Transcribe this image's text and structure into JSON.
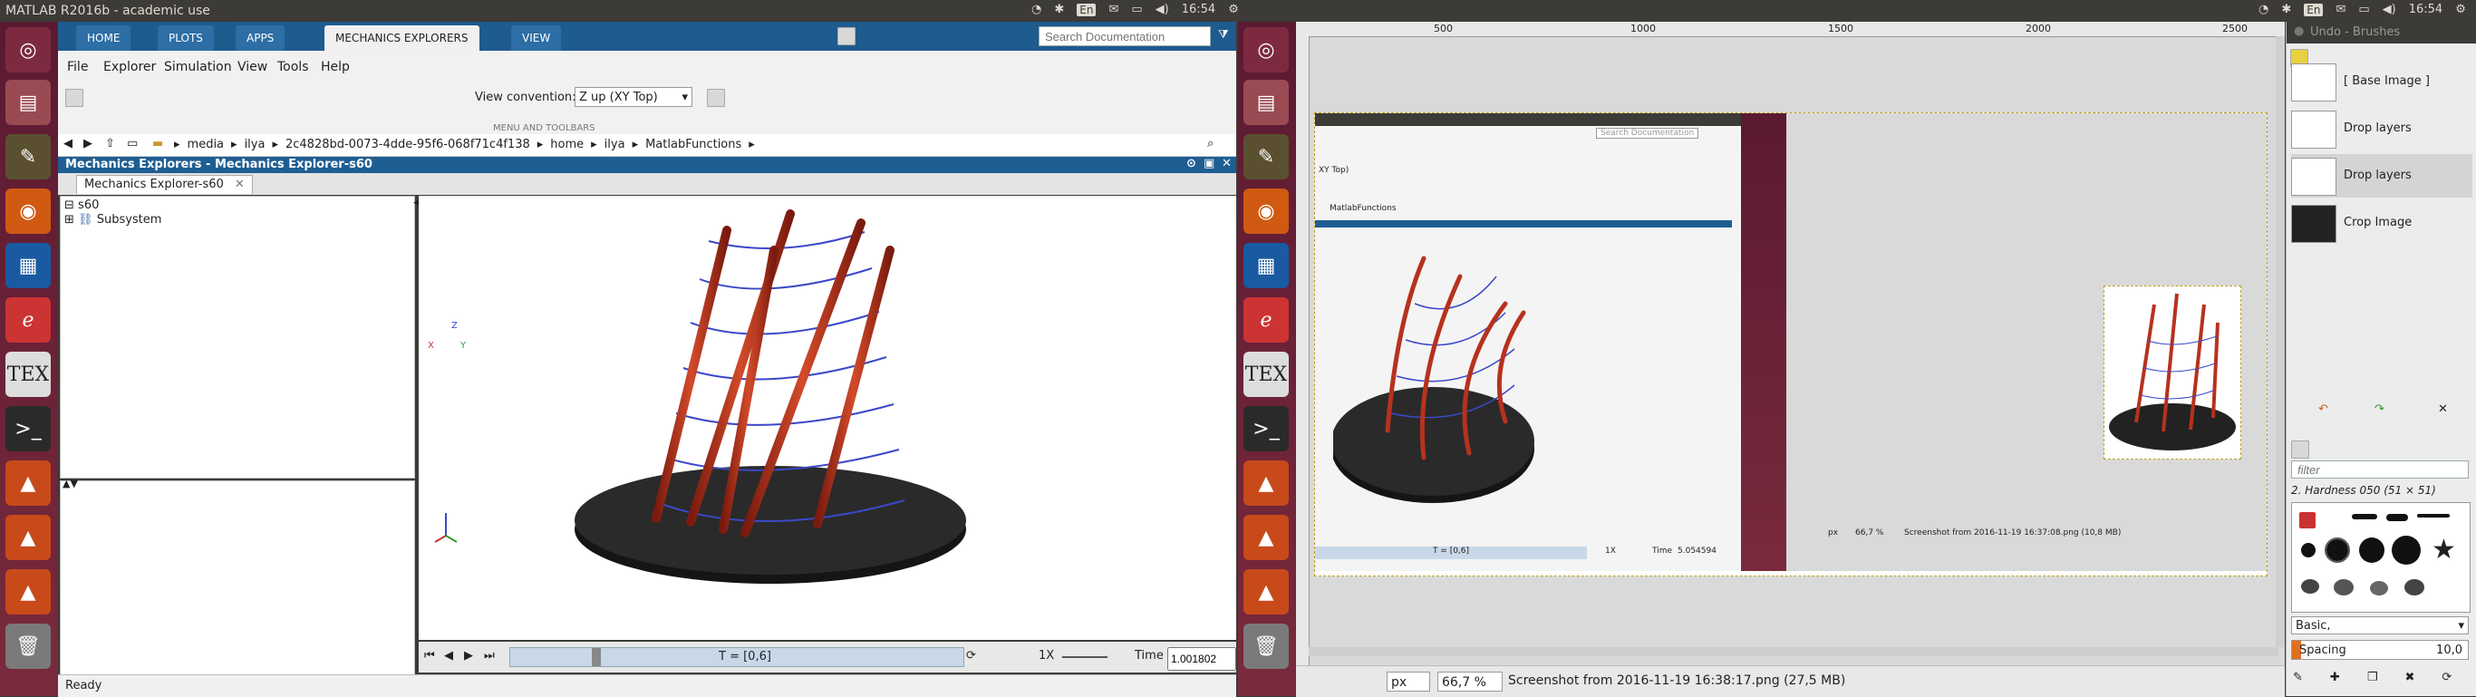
{
  "system": {
    "window_title": "MATLAB R2016b - academic use",
    "keyboard_layout": "En",
    "clock": "16:54"
  },
  "matlab": {
    "ribbon_tabs": [
      {
        "label": "HOME",
        "active": false
      },
      {
        "label": "PLOTS",
        "active": false
      },
      {
        "label": "APPS",
        "active": false
      },
      {
        "label": "MECHANICS EXPLORERS",
        "active": true
      },
      {
        "label": "VIEW",
        "active": false
      }
    ],
    "search_placeholder": "Search Documentation",
    "menus": [
      "File",
      "Explorer",
      "Simulation",
      "View",
      "Tools",
      "Help"
    ],
    "view_convention_label": "View convention:",
    "view_convention_value": "Z up (XY Top)",
    "toolstrip_caption": "MENU AND TOOLBARS",
    "path_segments": [
      "media",
      "ilya",
      "2c4828bd-0073-4dde-95f6-068f71c4f138",
      "home",
      "ilya",
      "MatlabFunctions"
    ],
    "window_title": "Mechanics Explorers - Mechanics Explorer-s60",
    "doc_tab": "Mechanics Explorer-s60",
    "tree": {
      "root": "s60",
      "child": "Subsystem"
    },
    "time_range": "T = [0,6]",
    "speed": "1X",
    "time_label": "Time",
    "time_value": "1.001802",
    "status": "Ready",
    "axes": {
      "z": "Z",
      "x": "X",
      "y": "Y"
    }
  },
  "gimp": {
    "ruler_labels": [
      "500",
      "1000",
      "1500",
      "2000",
      "2500"
    ],
    "units": "px",
    "zoom": "66,7 %",
    "status_text": "Screenshot from 2016-11-19 16:38:17.png (27,5 MB)",
    "nested": {
      "zoom": "66,7 %",
      "status_text": "Screenshot from 2016-11-19 16:37:08.png (10,8 MB)",
      "units": "px",
      "time_range": "T = [0,6]",
      "speed": "1X",
      "time_label": "Time",
      "time_value": "5.054594",
      "view_convention": "XY Top)",
      "path": "MatlabFunctions",
      "search_placeholder": "Search Documentation"
    }
  },
  "undo_panel": {
    "title": "Undo - Brushes",
    "items": [
      "[ Base Image ]",
      "Drop layers",
      "Drop layers",
      "Crop Image"
    ],
    "filter_placeholder": "filter",
    "brush_name": "2. Hardness 050 (51 × 51)",
    "preset": "Basic,",
    "spacing_label": "Spacing",
    "spacing_value": "10,0"
  },
  "colors": {
    "launcher": "#6e2236",
    "matlab_blue": "#1f5e92",
    "rod": "#b6321e",
    "base": "#222222",
    "ring": "#3b48c8"
  }
}
